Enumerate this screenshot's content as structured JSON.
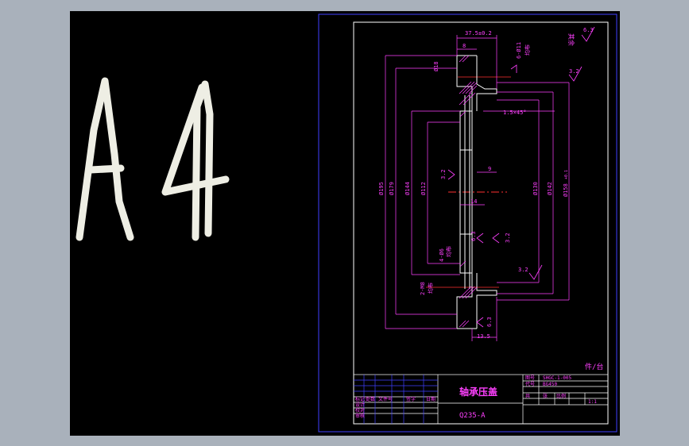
{
  "sheet_label": "A4",
  "part_name": "轴承压盖",
  "material": "Q235-A",
  "quantity_per_unit": "件/台",
  "tech_requirements": "其余",
  "drawing_number": "SHGC-1-005",
  "drawing_code": "BG450",
  "scale": "1:1",
  "surface_finish": {
    "general": "6.3",
    "right_face": "3.2",
    "left_face": "3.2",
    "bore": "3.2",
    "groove": "6.3",
    "bottom_face": "3.2",
    "hole": "6.3"
  },
  "dimensions": {
    "width_total": "37.5±0.2",
    "flange_thickness": "8",
    "hole_pattern": "6-Ø11",
    "hole_pattern_note": "均布",
    "dia_18": "Ø18",
    "chamfer": "1.5×45°",
    "dia_195": "Ø195",
    "dia_179": "Ø179",
    "dia_144": "Ø144",
    "dia_112": "Ø112",
    "dia_130": "Ø130",
    "dia_142": "Ø142",
    "dia_158": "Ø158",
    "dia_158_tol": "+0.1",
    "depth_9": "9",
    "depth_14": "14",
    "thread_left": "4-Ø6",
    "thread_left_note": "均布",
    "thread_bottom": "2-M8",
    "thread_bottom_note": "均布",
    "bottom_width": "13.5"
  },
  "title_block": {
    "label_mark": "标记",
    "label_count": "处数",
    "label_file": "文件号",
    "label_sign": "签字",
    "label_date": "日期",
    "label_design": "设计",
    "label_check": "校对",
    "label_review": "审核",
    "label_drawing_no": "图号",
    "label_code": "代号",
    "label_sheets": "共",
    "label_sheet": "张",
    "label_scale": "比例"
  }
}
